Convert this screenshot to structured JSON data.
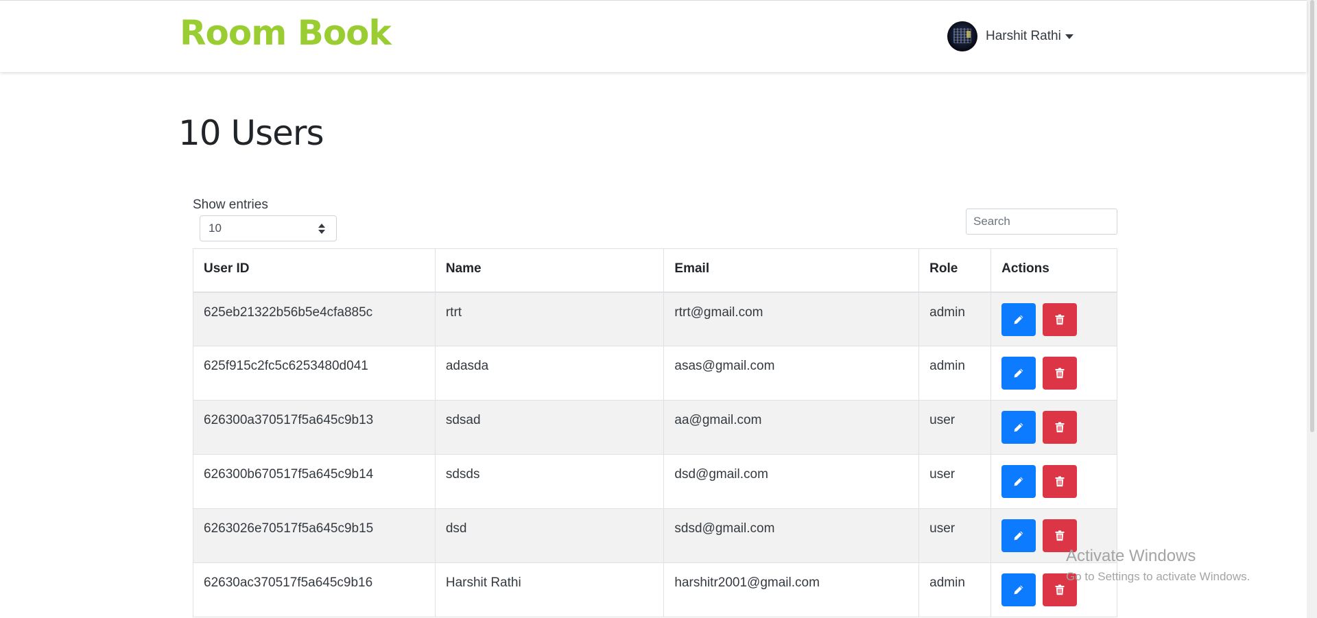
{
  "colors": {
    "brand": "#9acd32",
    "primary": "#0d7bff",
    "danger": "#dc3545"
  },
  "navbar": {
    "brand": "Room Book",
    "user": {
      "name": "Harshit Rathi"
    }
  },
  "main": {
    "title": "10 Users",
    "show_entries_label": "Show entries",
    "entries_selected": "10",
    "search_placeholder": "Search"
  },
  "table": {
    "headers": [
      "User ID",
      "Name",
      "Email",
      "Role",
      "Actions"
    ],
    "rows": [
      {
        "id": "625eb21322b56b5e4cfa885c",
        "name": "rtrt",
        "email": "rtrt@gmail.com",
        "role": "admin"
      },
      {
        "id": "625f915c2fc5c6253480d041",
        "name": "adasda",
        "email": "asas@gmail.com",
        "role": "admin"
      },
      {
        "id": "626300a370517f5a645c9b13",
        "name": "sdsad",
        "email": "aa@gmail.com",
        "role": "user"
      },
      {
        "id": "626300b670517f5a645c9b14",
        "name": "sdsds",
        "email": "dsd@gmail.com",
        "role": "user"
      },
      {
        "id": "6263026e70517f5a645c9b15",
        "name": "dsd",
        "email": "sdsd@gmail.com",
        "role": "user"
      },
      {
        "id": "62630ac370517f5a645c9b16",
        "name": "Harshit Rathi",
        "email": "harshitr2001@gmail.com",
        "role": "admin"
      }
    ],
    "icons": {
      "edit": "pencil-icon",
      "delete": "trash-icon"
    }
  },
  "watermark": {
    "title": "Activate Windows",
    "subtitle": "Go to Settings to activate Windows."
  }
}
